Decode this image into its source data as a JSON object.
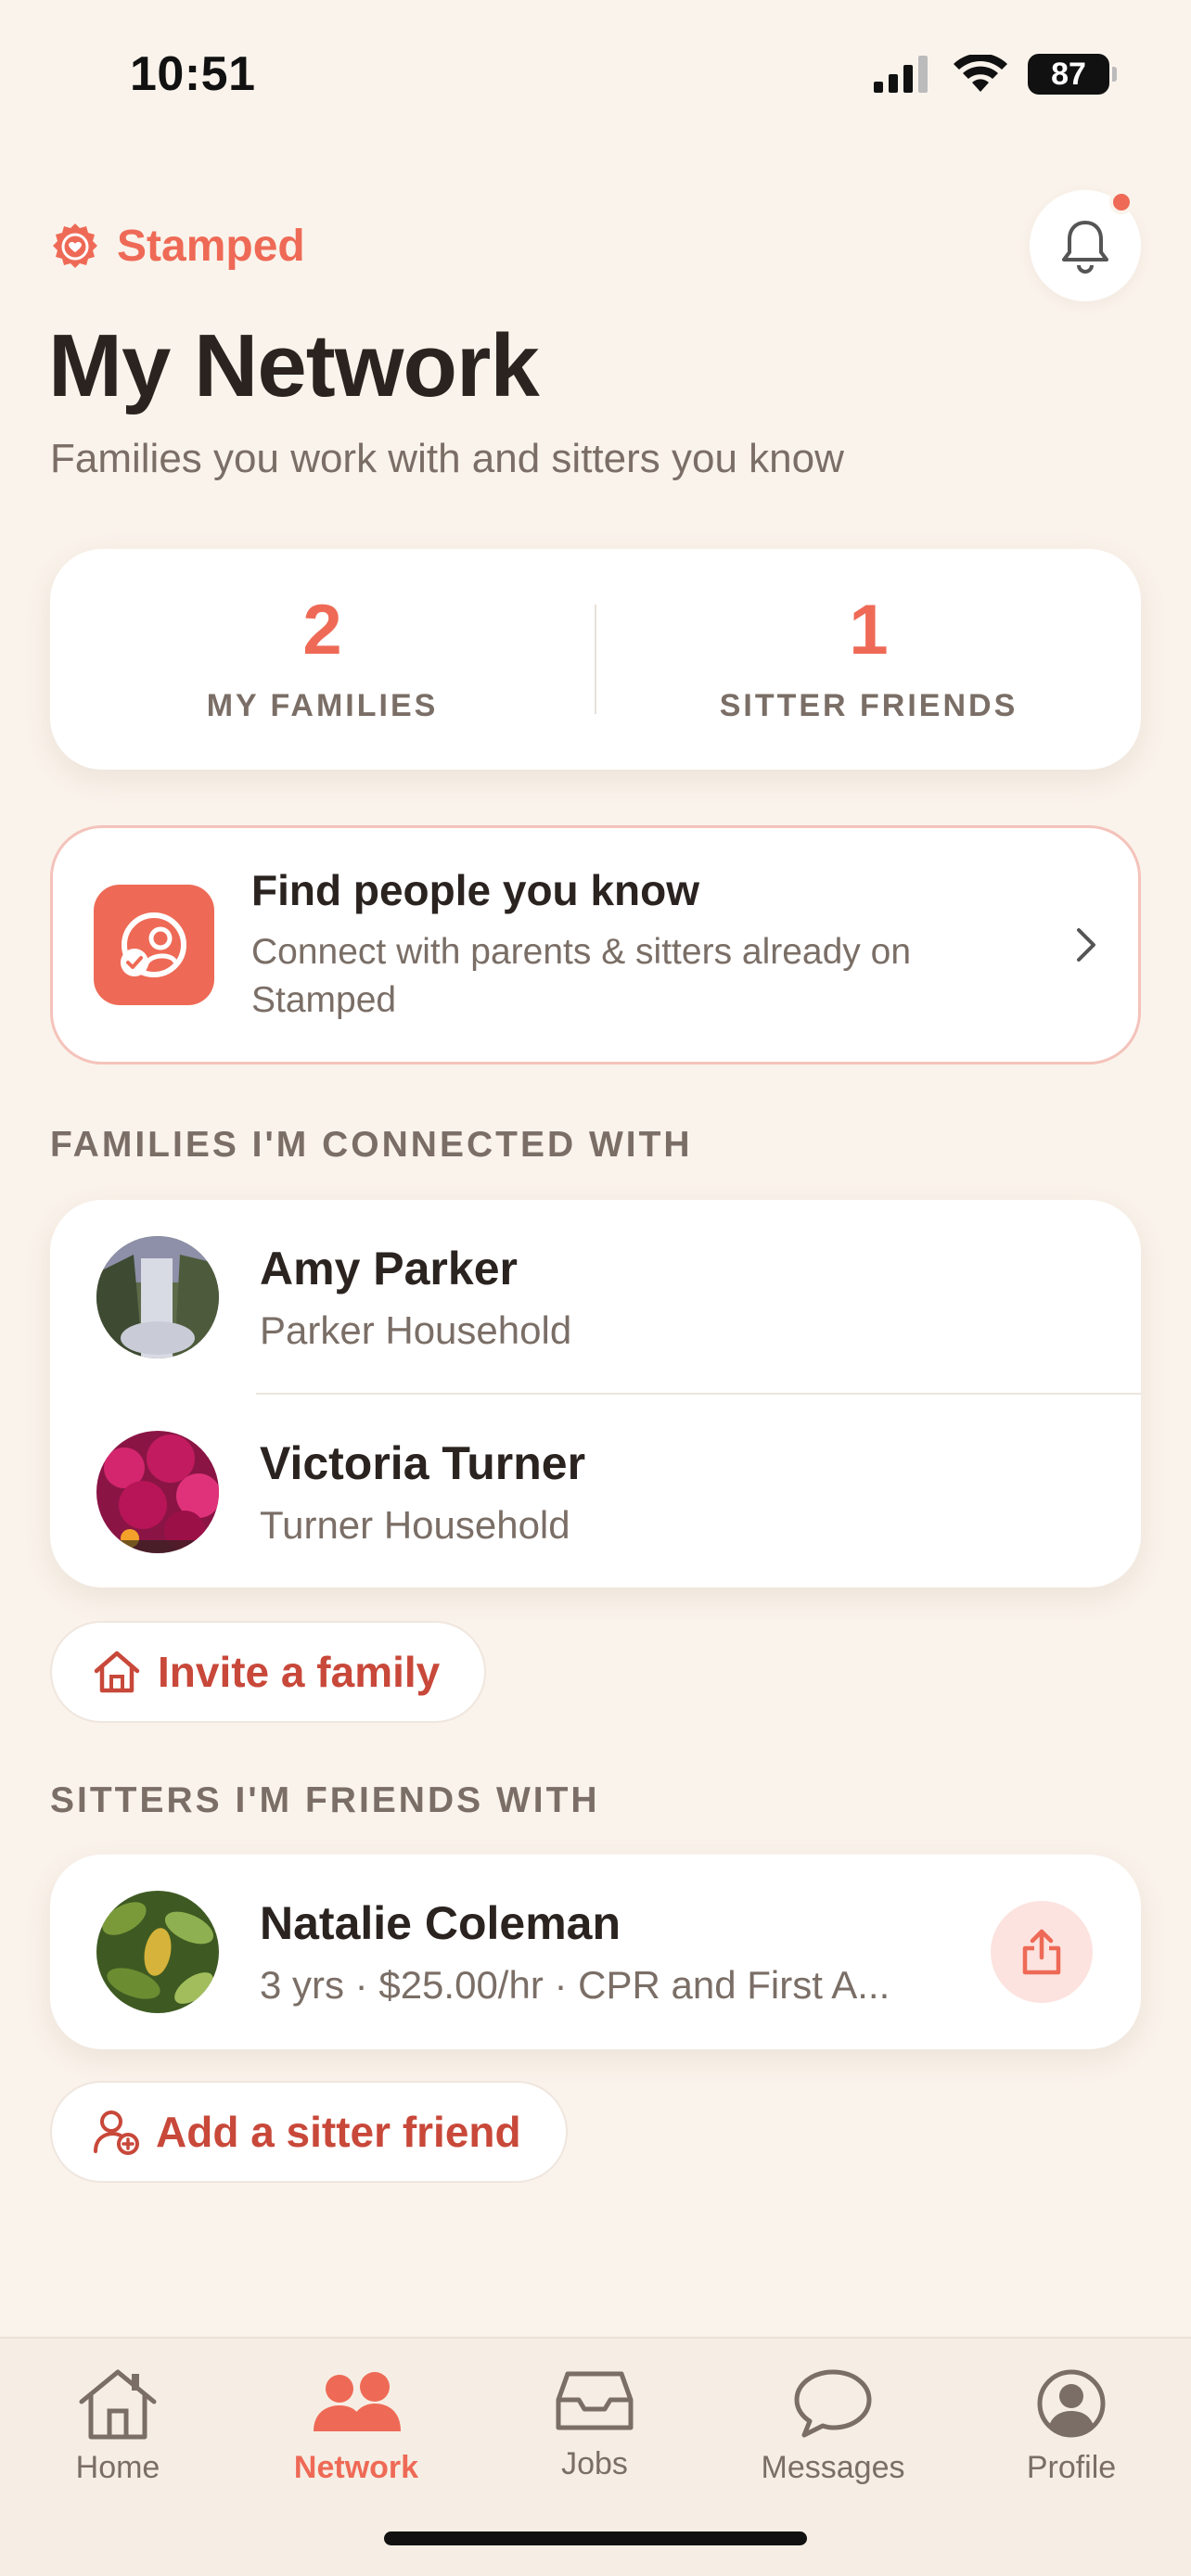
{
  "status_bar": {
    "time": "10:51",
    "battery": "87"
  },
  "brand": {
    "name": "Stamped",
    "accent_color": "#EE6A56"
  },
  "header": {
    "title": "My Network",
    "subtitle": "Families you work with and sitters you know",
    "notification_badge": true
  },
  "stats": [
    {
      "value": "2",
      "label": "MY FAMILIES"
    },
    {
      "value": "1",
      "label": "SITTER FRIENDS"
    }
  ],
  "find_people": {
    "title": "Find people you know",
    "description": "Connect with parents & sitters already on Stamped",
    "icon": "people-check-icon"
  },
  "families_section": {
    "heading": "FAMILIES I'M CONNECTED WITH",
    "items": [
      {
        "name": "Amy Parker",
        "household": "Parker Household",
        "avatar": "waterfall-photo"
      },
      {
        "name": "Victoria Turner",
        "household": "Turner Household",
        "avatar": "flowers-photo"
      }
    ],
    "invite_label": "Invite a family"
  },
  "sitters_section": {
    "heading": "SITTERS I'M FRIENDS WITH",
    "items": [
      {
        "name": "Natalie Coleman",
        "details": "3 yrs · $25.00/hr · CPR and First A...",
        "avatar": "leaves-photo"
      }
    ],
    "add_label": "Add a sitter friend"
  },
  "tabs": [
    {
      "label": "Home",
      "icon": "home-icon",
      "active": false
    },
    {
      "label": "Network",
      "icon": "people-icon",
      "active": true
    },
    {
      "label": "Jobs",
      "icon": "inbox-icon",
      "active": false
    },
    {
      "label": "Messages",
      "icon": "chat-bubble-icon",
      "active": false
    },
    {
      "label": "Profile",
      "icon": "profile-icon",
      "active": false
    }
  ]
}
